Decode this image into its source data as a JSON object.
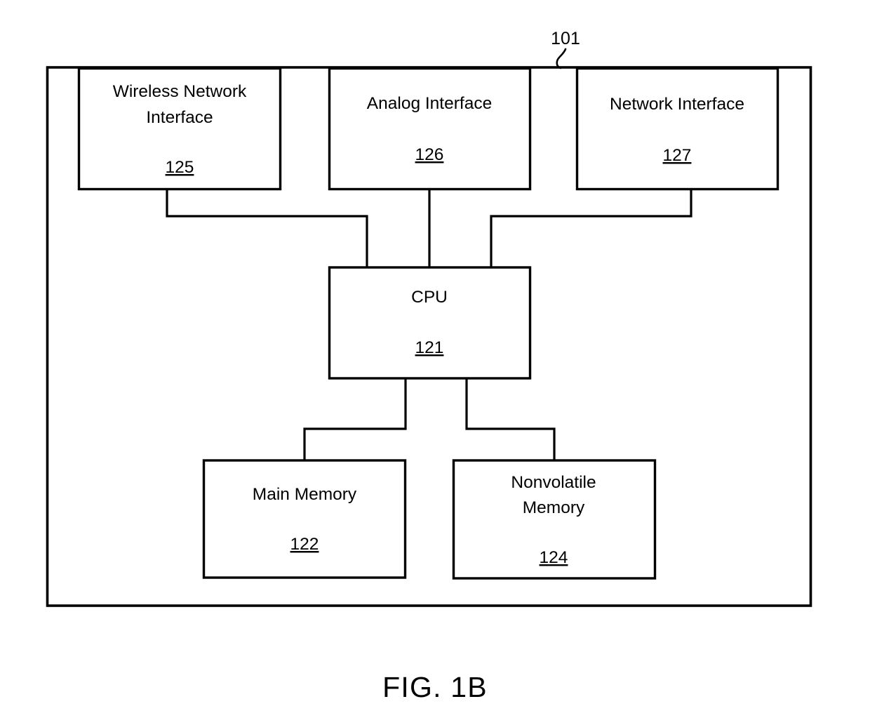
{
  "figure": {
    "caption": "FIG. 1B",
    "system_callout": "101"
  },
  "nodes": {
    "wireless_network_interface": {
      "label_line1": "Wireless Network",
      "label_line2": "Interface",
      "ref": "125"
    },
    "analog_interface": {
      "label_line1": "Analog Interface",
      "label_line2": "",
      "ref": "126"
    },
    "network_interface": {
      "label_line1": "Network Interface",
      "label_line2": "",
      "ref": "127"
    },
    "cpu": {
      "label_line1": "CPU",
      "label_line2": "",
      "ref": "121"
    },
    "main_memory": {
      "label_line1": "Main Memory",
      "label_line2": "",
      "ref": "122"
    },
    "nonvolatile_memory": {
      "label_line1": "Nonvolatile",
      "label_line2": "Memory",
      "ref": "124"
    }
  },
  "colors": {
    "stroke": "#000000",
    "fill": "#ffffff",
    "background": "#ffffff"
  }
}
